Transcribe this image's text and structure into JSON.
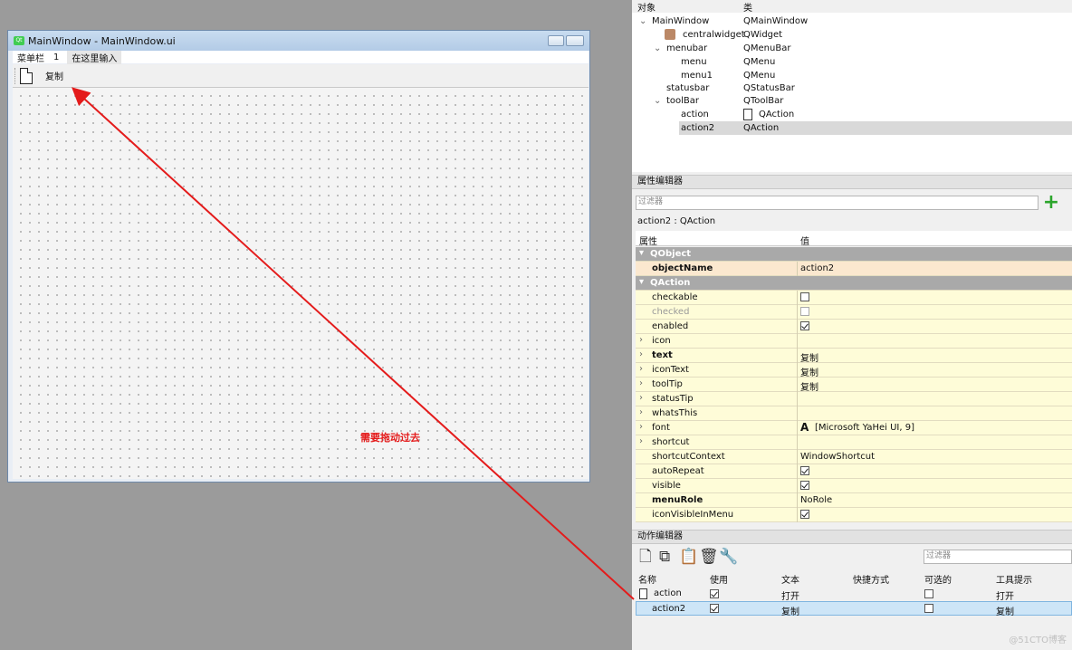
{
  "form": {
    "title": "MainWindow - MainWindow.ui",
    "menus": [
      "菜单栏",
      "1"
    ],
    "menu_hint": "在这里输入",
    "toolbar_action": "复制"
  },
  "annotation": "需要拖动过去",
  "object_inspector": {
    "col_object": "对象",
    "col_class": "类",
    "rows": [
      {
        "name": "MainWindow",
        "cls": "QMainWindow"
      },
      {
        "name": "centralwidget",
        "cls": "QWidget"
      },
      {
        "name": "menubar",
        "cls": "QMenuBar"
      },
      {
        "name": "menu",
        "cls": "QMenu"
      },
      {
        "name": "menu1",
        "cls": "QMenu"
      },
      {
        "name": "statusbar",
        "cls": "QStatusBar"
      },
      {
        "name": "toolBar",
        "cls": "QToolBar"
      },
      {
        "name": "action",
        "cls": "QAction"
      },
      {
        "name": "action2",
        "cls": "QAction"
      }
    ]
  },
  "property_editor": {
    "title": "属性编辑器",
    "filter_placeholder": "过滤器",
    "context": "action2 : QAction",
    "col_property": "属性",
    "col_value": "值",
    "group_qobject": "QObject",
    "object_name_key": "objectName",
    "object_name_value": "action2",
    "group_qaction": "QAction",
    "rows": [
      {
        "k": "checkable",
        "v": ""
      },
      {
        "k": "checked",
        "v": ""
      },
      {
        "k": "enabled",
        "v": ""
      },
      {
        "k": "icon",
        "v": ""
      },
      {
        "k": "text",
        "v": "复制"
      },
      {
        "k": "iconText",
        "v": "复制"
      },
      {
        "k": "toolTip",
        "v": "复制"
      },
      {
        "k": "statusTip",
        "v": ""
      },
      {
        "k": "whatsThis",
        "v": ""
      },
      {
        "k": "font",
        "v": "[Microsoft YaHei UI, 9]"
      },
      {
        "k": "shortcut",
        "v": ""
      },
      {
        "k": "shortcutContext",
        "v": "WindowShortcut"
      },
      {
        "k": "autoRepeat",
        "v": ""
      },
      {
        "k": "visible",
        "v": ""
      },
      {
        "k": "menuRole",
        "v": "NoRole"
      },
      {
        "k": "iconVisibleInMenu",
        "v": ""
      }
    ]
  },
  "action_editor": {
    "title": "动作编辑器",
    "filter_placeholder": "过滤器",
    "headers": [
      "名称",
      "使用",
      "文本",
      "快捷方式",
      "可选的",
      "工具提示"
    ],
    "rows": [
      {
        "name": "action",
        "text": "打开",
        "tip": "打开"
      },
      {
        "name": "action2",
        "text": "复制",
        "tip": "复制"
      }
    ]
  },
  "watermark": "@51CTO博客"
}
